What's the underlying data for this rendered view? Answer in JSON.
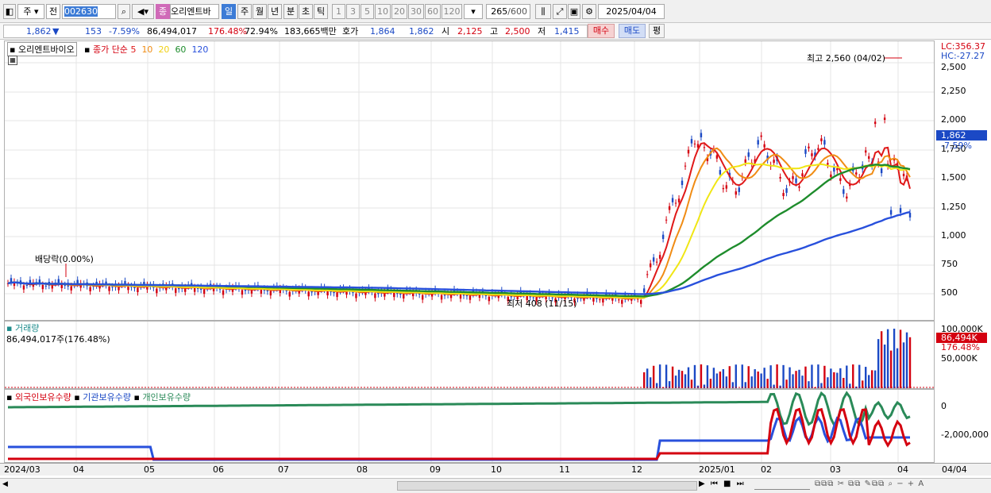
{
  "toolbar": {
    "mode1": "주",
    "mode2": "전",
    "code": "002630",
    "name": "오리엔트바",
    "period_tag": "종",
    "periods": [
      "일",
      "주",
      "월",
      "년",
      "분",
      "초",
      "틱"
    ],
    "intervals": [
      "1",
      "3",
      "5",
      "10",
      "20",
      "30",
      "60",
      "120"
    ],
    "count": "265",
    "count_max": "/600",
    "date": "2025/04/04"
  },
  "quote": {
    "price": "1,862",
    "arrow": "▼",
    "change": "153",
    "rate": "-7.59%",
    "volume": "86,494,017",
    "vol_rate": "176.48%",
    "turnover": "72.94%",
    "amount": "183,665백만",
    "bid_label": "호가",
    "bid": "1,864",
    "ask": "1,862",
    "open_label": "시",
    "open": "2,125",
    "high_label": "고",
    "high": "2,500",
    "low_label": "저",
    "low": "1,415",
    "buy": "매수",
    "sell": "매도",
    "avg": "평"
  },
  "price_pane": {
    "stock": "오리엔트바이오",
    "ma_label": "종가 단순",
    "ma": [
      "5",
      "10",
      "20",
      "60",
      "120"
    ],
    "ma_colors": [
      "#e01818",
      "#f08c14",
      "#f0e614",
      "#1e8c2c",
      "#2850dc"
    ],
    "lc": "LC:356.37",
    "hc": "HC:-27.27",
    "high_note": "최고 2,560 (04/02)",
    "low_note": "최저 408 (11/15)",
    "div_note": "배당락(0.00%)",
    "ticks": [
      "2,500",
      "2,250",
      "2,000",
      "1,750",
      "1,500",
      "1,250",
      "1,000",
      "750",
      "500"
    ],
    "cur": "1,862",
    "cur_rate": "-7.59%"
  },
  "volume_pane": {
    "title": "거래량",
    "value": "86,494,017주(176.48%)",
    "ticks": [
      "100,000K",
      "50,000K"
    ],
    "cur": "86,494K",
    "cur_rate": "176.48%"
  },
  "holding_pane": {
    "legend": [
      "외국인보유수량",
      "기관보유수량",
      "개인보유수량"
    ],
    "colors": [
      "#d4000f",
      "#2850dc",
      "#2a8a58"
    ],
    "ticks": [
      "0",
      "-2,000,000"
    ]
  },
  "xaxis": [
    "2024/03",
    "04",
    "05",
    "06",
    "07",
    "08",
    "09",
    "10",
    "11",
    "12",
    "2025/01",
    "02",
    "03",
    "04"
  ],
  "xaxis_end": "04/04"
}
